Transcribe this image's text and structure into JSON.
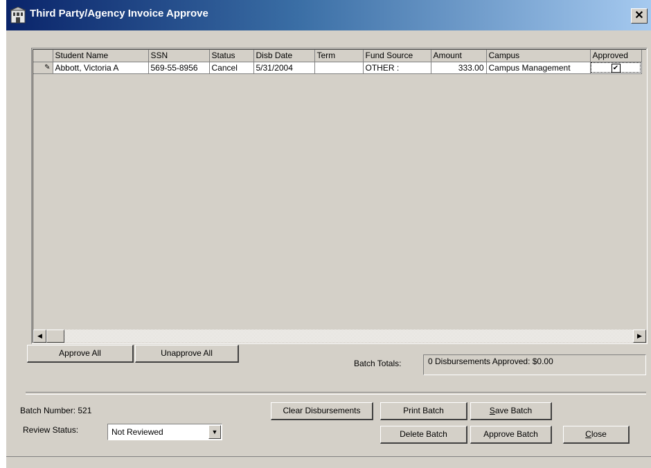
{
  "window": {
    "title": "Third Party/Agency Invoice Approve",
    "close_glyph": "✕"
  },
  "grid": {
    "columns": [
      "Student Name",
      "SSN",
      "Status",
      "Disb Date",
      "Term",
      "Fund Source",
      "Amount",
      "Campus",
      "Approved"
    ],
    "rows": [
      {
        "row_indicator": "✎",
        "student_name": "Abbott, Victoria A",
        "ssn": "569-55-8956",
        "status": "Cancel",
        "disb_date": "5/31/2004",
        "term": "",
        "fund_source": "OTHER :",
        "amount": "333.00",
        "campus": "Campus Management",
        "approved": "✔"
      }
    ]
  },
  "buttons": {
    "approve_all": "Approve All",
    "unapprove_all": "Unapprove All",
    "clear_disbursements": "Clear Disbursements",
    "print_batch": "Print Batch",
    "save_batch_key": "S",
    "save_batch_rest": "ave Batch",
    "delete_batch": "Delete Batch",
    "approve_batch": "Approve Batch",
    "close_key": "C",
    "close_rest": "lose"
  },
  "totals": {
    "label": "Batch Totals:",
    "value": "0 Disbursements Approved: $0.00"
  },
  "batch": {
    "number_label": "Batch Number: 521",
    "review_status_label": "Review Status:",
    "review_status_value": "Not Reviewed"
  },
  "colors": {
    "titlebar_start": "#0a246a",
    "titlebar_end": "#a6caf0",
    "window_bg": "#d4d0c8"
  }
}
